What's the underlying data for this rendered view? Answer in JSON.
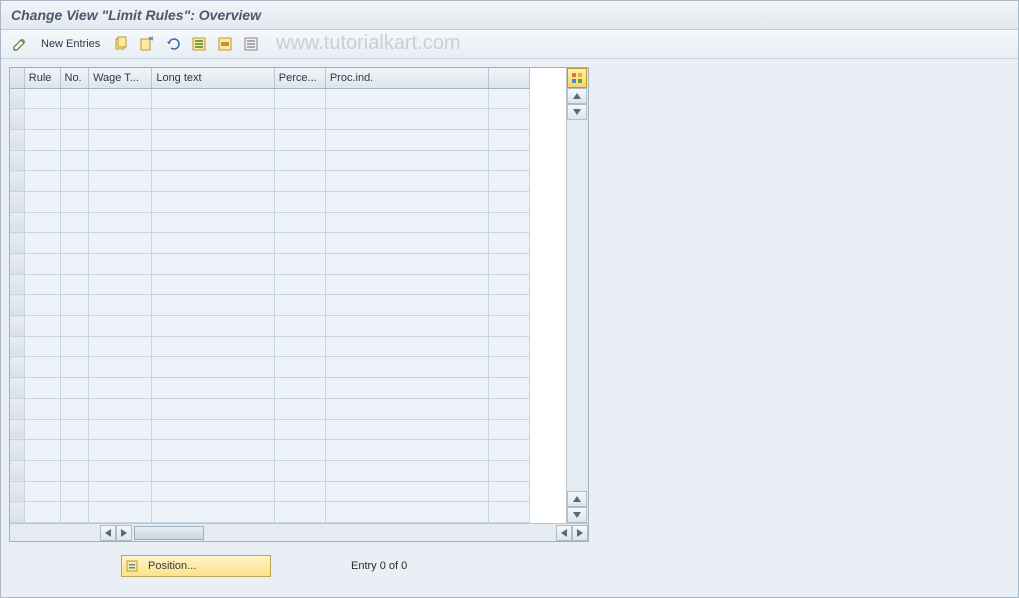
{
  "title": "Change View \"Limit Rules\": Overview",
  "watermark": "www.tutorialkart.com",
  "toolbar": {
    "new_entries_label": "New Entries"
  },
  "table": {
    "columns": [
      "Rule",
      "No.",
      "Wage T...",
      "Long text",
      "Perce...",
      "Proc.ind."
    ],
    "row_count": 21,
    "rows": []
  },
  "footer": {
    "position_label": "Position...",
    "entry_text": "Entry 0 of 0"
  }
}
